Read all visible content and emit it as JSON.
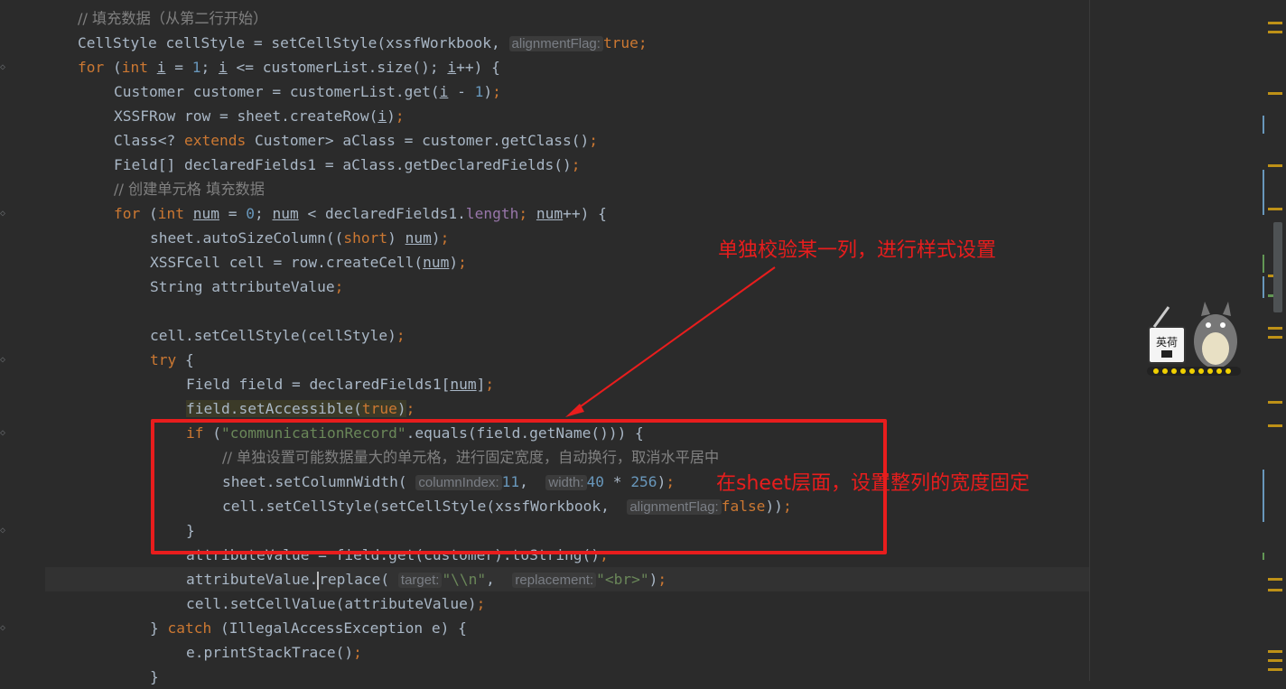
{
  "code_lines": {
    "l1": "// 填充数据（从第二行开始）",
    "l2a": "CellStyle cellStyle = setCellStyle(xssfWorkbook, ",
    "l2hint": "alignmentFlag:",
    "l2b": "true",
    "l2c": ");",
    "l8": "// 创建单元格 填充数据",
    "l18cmt": "// 单独设置可能数据量大的单元格，进行固定宽度，自动换行，取消水平居中",
    "l19hint1": "columnIndex:",
    "l19hint2": "width:",
    "l20hint": "alignmentFlag:",
    "l24hint1": "target:",
    "l24hint2": "replacement:",
    "str_comm": "\"communicationRecord\"",
    "str_n": "\"\\\\n\"",
    "str_br": "\"<br>\""
  },
  "annotations": {
    "top": "单独校验某一列，进行样式设置",
    "side": "在sheet层面，设置整列的宽度固定"
  },
  "mascot": {
    "sign_text": "英荷"
  },
  "colors": {
    "background": "#2b2b2b",
    "keyword": "#cc7832",
    "number": "#6897bb",
    "string": "#6a8759",
    "comment": "#808080",
    "field": "#9876aa",
    "annotation_red": "#e81d1d",
    "scroll_marker": "#be9117"
  }
}
